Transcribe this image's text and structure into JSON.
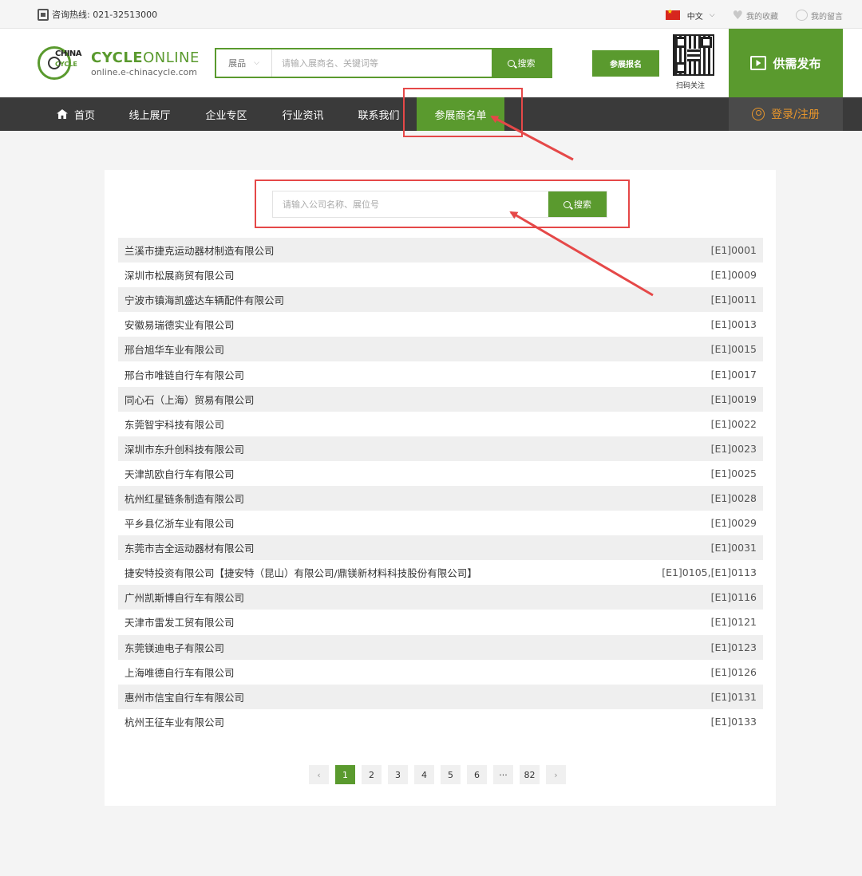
{
  "topbar": {
    "hotline": "咨询热线: 021-32513000",
    "language": "中文",
    "favorites": "我的收藏",
    "messages": "我的留言"
  },
  "header": {
    "logo_china": "CHINA",
    "logo_cycle_small": "CYCLE",
    "logo_cycle": "CYCLE",
    "logo_online": "ONLINE",
    "logo_url": "online.e-chinacycle.com",
    "search_category": "展品",
    "search_placeholder": "请输入展商名、关键词等",
    "search_button": "搜索",
    "signup_button": "参展报名",
    "qr_label": "扫码关注",
    "publish_button": "供需发布"
  },
  "nav": {
    "items": [
      "首页",
      "线上展厅",
      "企业专区",
      "行业资讯",
      "联系我们",
      "参展商名单"
    ],
    "active_index": 5,
    "login": "登录/注册"
  },
  "panel": {
    "search_placeholder": "请输入公司名称、展位号",
    "search_button": "搜索",
    "rows": [
      {
        "name": "兰溪市捷克运动器材制造有限公司",
        "booth": "[E1]0001"
      },
      {
        "name": "深圳市松展商贸有限公司",
        "booth": "[E1]0009"
      },
      {
        "name": "宁波市镇海凯盛达车辆配件有限公司",
        "booth": "[E1]0011"
      },
      {
        "name": "安徽易瑞德实业有限公司",
        "booth": "[E1]0013"
      },
      {
        "name": "邢台旭华车业有限公司",
        "booth": "[E1]0015"
      },
      {
        "name": "邢台市唯链自行车有限公司",
        "booth": "[E1]0017"
      },
      {
        "name": "同心石（上海）贸易有限公司",
        "booth": "[E1]0019"
      },
      {
        "name": "东莞智宇科技有限公司",
        "booth": "[E1]0022"
      },
      {
        "name": "深圳市东升创科技有限公司",
        "booth": "[E1]0023"
      },
      {
        "name": "天津凯欧自行车有限公司",
        "booth": "[E1]0025"
      },
      {
        "name": "杭州红星链条制造有限公司",
        "booth": "[E1]0028"
      },
      {
        "name": "平乡县亿浙车业有限公司",
        "booth": "[E1]0029"
      },
      {
        "name": "东莞市吉全运动器材有限公司",
        "booth": "[E1]0031"
      },
      {
        "name": "捷安特投资有限公司【捷安特（昆山）有限公司/鼎镁新材料科技股份有限公司】",
        "booth": "[E1]0105,[E1]0113"
      },
      {
        "name": "广州凯斯博自行车有限公司",
        "booth": "[E1]0116"
      },
      {
        "name": "天津市雷发工贸有限公司",
        "booth": "[E1]0121"
      },
      {
        "name": "东莞镁迪电子有限公司",
        "booth": "[E1]0123"
      },
      {
        "name": "上海唯德自行车有限公司",
        "booth": "[E1]0126"
      },
      {
        "name": "惠州市信宝自行车有限公司",
        "booth": "[E1]0131"
      },
      {
        "name": "杭州王征车业有限公司",
        "booth": "[E1]0133"
      }
    ]
  },
  "pager": {
    "prev": "‹",
    "pages": [
      "1",
      "2",
      "3",
      "4",
      "5",
      "6",
      "···",
      "82"
    ],
    "active_page": "1",
    "next": "›"
  },
  "colors": {
    "brand_green": "#5a9a2e",
    "nav_dark": "#3a3a3a",
    "login_orange": "#e8962c",
    "annotation_red": "#e54848"
  }
}
